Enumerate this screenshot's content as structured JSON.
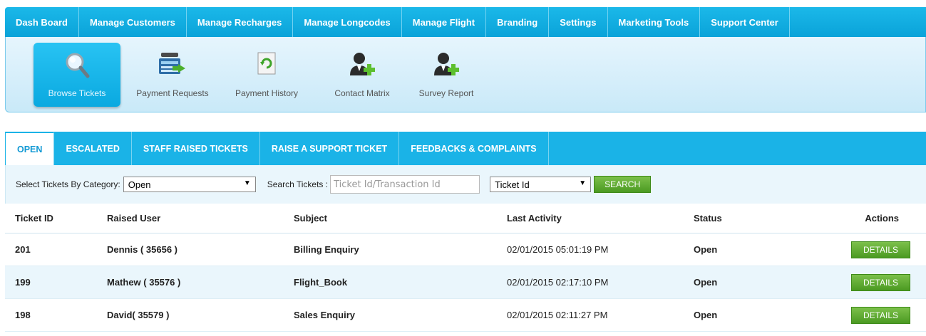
{
  "topnav": {
    "items": [
      "Dash Board",
      "Manage Customers",
      "Manage Recharges",
      "Manage Longcodes",
      "Manage Flight",
      "Branding",
      "Settings",
      "Marketing Tools",
      "Support Center"
    ]
  },
  "toolbar": {
    "items": [
      {
        "label": "Browse Tickets",
        "icon": "magnifier-icon"
      },
      {
        "label": "Payment Requests",
        "icon": "cash-register-icon"
      },
      {
        "label": "Payment History",
        "icon": "refresh-document-icon"
      },
      {
        "label": "Contact Matrix",
        "icon": "add-user-icon"
      },
      {
        "label": "Survey Report",
        "icon": "add-user-icon"
      }
    ],
    "active": "Browse Tickets"
  },
  "tabs": [
    "OPEN",
    "ESCALATED",
    "STAFF RAISED TICKETS",
    "RAISE A SUPPORT TICKET",
    "FEEDBACKS & COMPLAINTS"
  ],
  "filters": {
    "category_label": "Select Tickets By Category:",
    "category_value": "Open",
    "search_label": "Search Tickets :",
    "search_placeholder": "Ticket Id/Transaction Id",
    "search_by_value": "Ticket Id",
    "search_button": "SEARCH"
  },
  "table": {
    "headers": [
      "Ticket ID",
      "Raised User",
      "Subject",
      "Last Activity",
      "Status",
      "Actions"
    ],
    "rows": [
      {
        "id": "201",
        "user": "Dennis ( 35656 )",
        "subject": "Billing Enquiry",
        "last_activity": "02/01/2015 05:01:19 PM",
        "status": "Open",
        "action": "DETAILS"
      },
      {
        "id": "199",
        "user": "Mathew ( 35576 )",
        "subject": "Flight_Book",
        "last_activity": "02/01/2015 02:17:10 PM",
        "status": "Open",
        "action": "DETAILS"
      },
      {
        "id": "198",
        "user": "David( 35579 )",
        "subject": "Sales Enquiry",
        "last_activity": "02/01/2015 02:11:27 PM",
        "status": "Open",
        "action": "DETAILS"
      }
    ]
  },
  "colors": {
    "nav_blue": "#0aa3d9",
    "toolbar_bg": "#d6eefa",
    "button_green": "#5aa82e"
  }
}
